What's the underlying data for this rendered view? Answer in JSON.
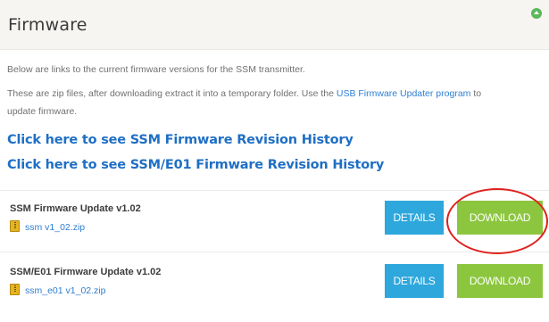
{
  "header": {
    "title": "Firmware"
  },
  "intro": {
    "line1": "Below are links to the current firmware versions for the SSM transmitter.",
    "line2_before": "These are zip files, after downloading extract it into a temporary folder. Use the ",
    "line2_link": "USB Firmware Updater program",
    "line2_after": " to",
    "line3": "update firmware."
  },
  "history_links": [
    "Click here to see SSM Firmware Revision History",
    "Click here to see SSM/E01 Firmware Revision History"
  ],
  "firmware": [
    {
      "title": "SSM Firmware Update v1.02",
      "file": "ssm v1_02.zip",
      "details_label": "DETAILS",
      "download_label": "DOWNLOAD"
    },
    {
      "title": "SSM/E01 Firmware Update v1.02",
      "file": "ssm_e01 v1_02.zip",
      "details_label": "DETAILS",
      "download_label": "DOWNLOAD"
    }
  ],
  "colors": {
    "link": "#2d7fd3",
    "details_button": "#2ea7dc",
    "download_button": "#8cc63f",
    "highlight_ring": "#e0201c",
    "collapse_icon": "#5cb85c"
  },
  "icons": {
    "collapse": "chevron-up-circle-icon",
    "zip": "zip-file-icon"
  }
}
